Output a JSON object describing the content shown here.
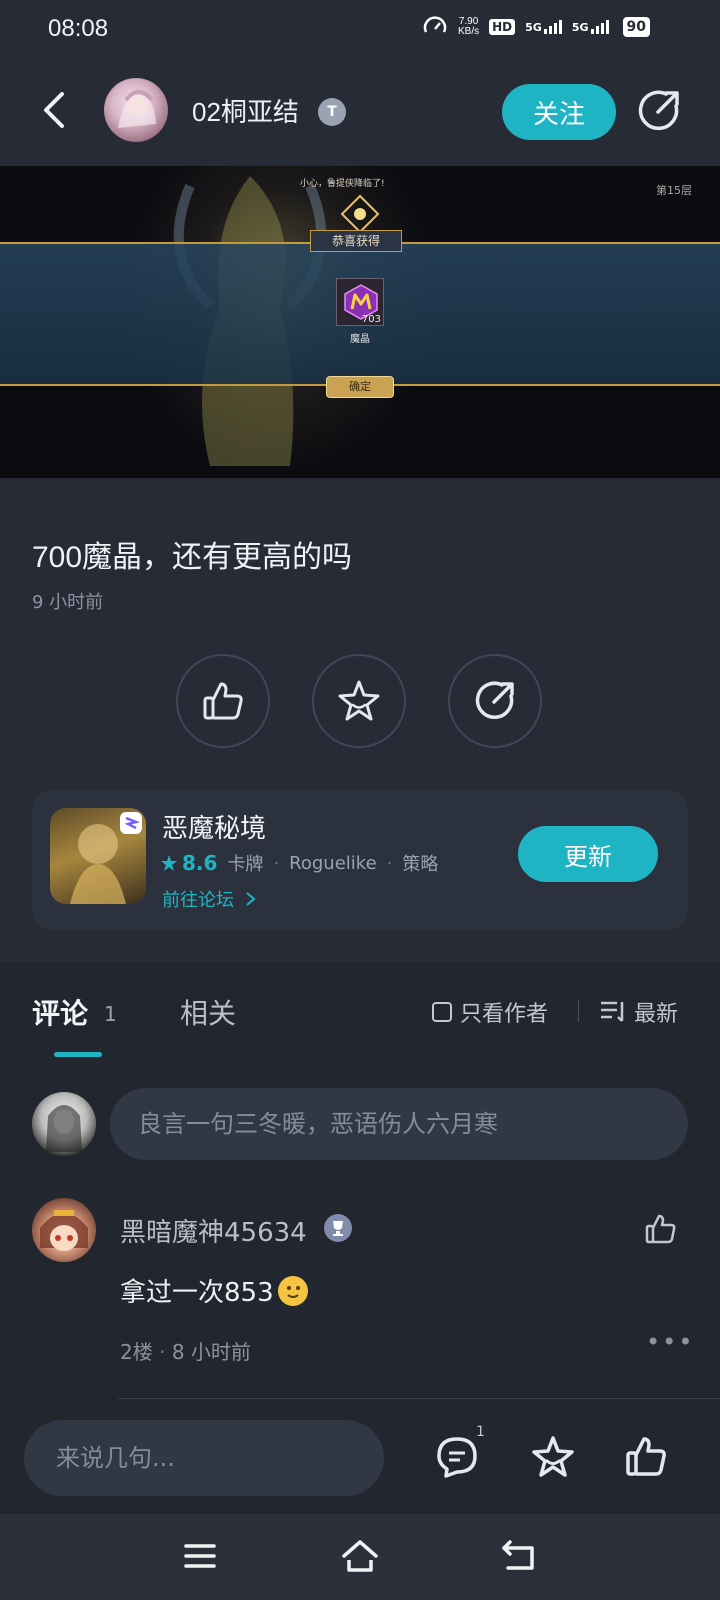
{
  "status_bar": {
    "time": "08:08",
    "net_speed": "7.90",
    "net_unit": "KB/s",
    "hd": "HD",
    "sim1": "5G",
    "sim2": "5G",
    "battery": "90"
  },
  "header": {
    "author_name": "02桐亚结",
    "author_badge": "T",
    "follow_label": "关注"
  },
  "banner": {
    "tip": "小心，鲁提侠降临了!",
    "level": "第15层",
    "title_plate": "恭喜获得",
    "item_qty": "703",
    "item_name": "魔晶",
    "confirm_label": "确定"
  },
  "post": {
    "title": "700魔晶，还有更高的吗",
    "time": "9 小时前"
  },
  "game_card": {
    "name": "恶魔秘境",
    "rating": "8.6",
    "tags": [
      "卡牌",
      "Roguelike",
      "策略"
    ],
    "forum_link": "前往论坛",
    "update_label": "更新"
  },
  "comments": {
    "tab_comments": "评论",
    "tab_comments_count": "1",
    "tab_related": "相关",
    "author_only": "只看作者",
    "sort_label": "最新",
    "input_placeholder": "良言一句三冬暖，恶语伤人六月寒",
    "items": [
      {
        "name": "黑暗魔神45634",
        "text": "拿过一次853",
        "floor": "2楼",
        "time": "8 小时前"
      }
    ]
  },
  "bottom_bar": {
    "reply_placeholder": "来说几句...",
    "comment_count": "1"
  },
  "colors": {
    "accent": "#1fb4c3",
    "background": "#272b36",
    "card": "#2c313e"
  }
}
